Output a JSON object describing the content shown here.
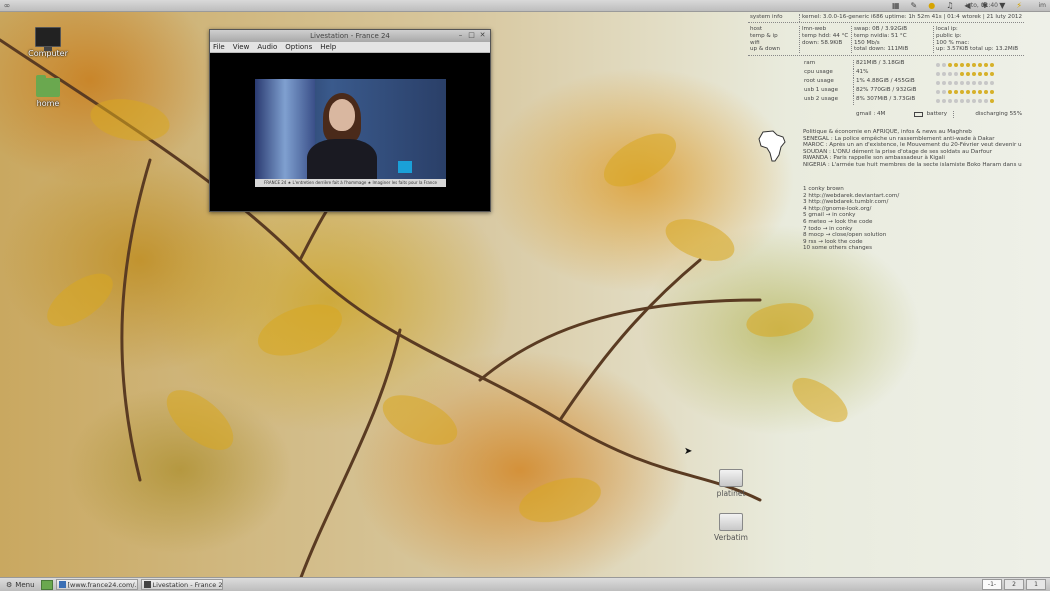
{
  "top_panel": {
    "clock": "wto, 01:40",
    "user": "im",
    "tray_icons": [
      "cpu-icon",
      "notes-icon",
      "weather-icon",
      "music-icon",
      "volume-icon",
      "bluetooth-icon",
      "wifi-icon",
      "power-icon"
    ]
  },
  "desktop_icons": [
    {
      "label": "Computer"
    },
    {
      "label": "home"
    },
    {
      "label": "platinet"
    },
    {
      "label": "Verbatim"
    }
  ],
  "video_window": {
    "title": "Livestation - France 24",
    "menu": [
      "File",
      "View",
      "Audio",
      "Options",
      "Help"
    ],
    "ticker": "FRANCE 24 ★ L'entretien derrière fait à l'hommage ★ Imaginer les faits pour la France"
  },
  "conky": {
    "header": {
      "system_info": "system info",
      "kernel": "kernel: 3.0.0-16-generic i686  uptime: 1h 52m 41s | 01:40",
      "date": "wtorek | 21 luty 2012"
    },
    "col1": [
      "host",
      "temp & ip",
      "wifi",
      "up & down"
    ],
    "col2": [
      "lmn-web",
      "temp hdd: 44 °C",
      "",
      "down: 58.9KiB"
    ],
    "col3": [
      "swap: 0B  / 3.92GiB",
      "temp nvidia: 51 °C",
      "150 Mb/s",
      "total down: 111MiB"
    ],
    "col4": [
      "local ip:",
      "public ip:",
      "100 %   mac:",
      "up: 3.57KiB    total up: 13.2MiB"
    ],
    "resources": [
      {
        "label": "ram",
        "value": "821MiB / 3.18GiB",
        "on": 8
      },
      {
        "label": "cpu usage",
        "value": "41%",
        "on": 6
      },
      {
        "label": "root usage",
        "value": "1%  4.88GiB / 455GiB",
        "on": 0
      },
      {
        "label": "usb 1 usage",
        "value": "82%  770GiB / 932GiB",
        "on": 8
      },
      {
        "label": "usb 2 usage",
        "value": "8%  307MiB / 3.73GiB",
        "on": 1
      }
    ],
    "gmail": "gmail : 4M",
    "battery_label": "battery",
    "battery_status": "discharging 55%"
  },
  "news": {
    "headline": "Politique & économie en AFRIQUE, infos & news au Maghreb",
    "items": [
      "SENEGAL : La police empêche un rassemblement anti-wade à Dakar",
      "MAROC : Après un an d'existence, le Mouvement du 20-Février veut devenir u",
      "SOUDAN : L'ONU dément la prise d'otage de ses soldats au Darfour",
      "RWANDA : Paris rappelle son ambassadeur à Kigali",
      "NIGERIA : L'armée tue huit membres de la secte islamiste Boko Haram dans u"
    ]
  },
  "links": [
    "1 conky brown",
    "2 http://webdarek.deviantart.com/",
    "3 http://webdarek.tumblr.com/",
    "4 http://gnome-look.org/",
    "5 gmail → in conky",
    "6 meteo → look the code",
    "7 todo → in conky",
    "8 mocp → close/open solution",
    "9 rss → look the code",
    "10 some others changes"
  ],
  "bottom_panel": {
    "menu_label": "Menu",
    "tasks": [
      {
        "label": "[www.france24.com/..."
      },
      {
        "label": "Livestation - France 24"
      }
    ],
    "workspaces": [
      "-1-",
      "2",
      "1"
    ]
  }
}
